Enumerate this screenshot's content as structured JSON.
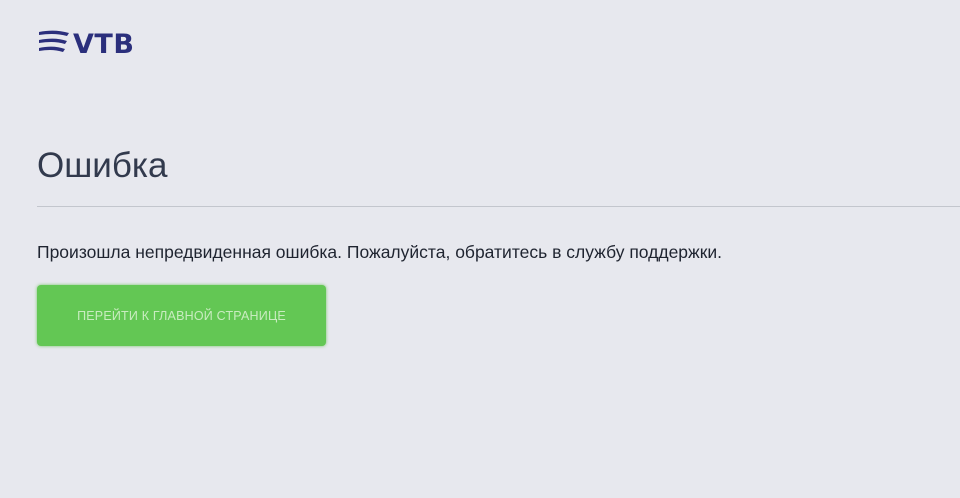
{
  "brand": {
    "logo_text": "VTB",
    "brand_color": "#2b2f7c"
  },
  "error": {
    "title": "Ошибка",
    "message": "Произошла непредвиденная ошибка. Пожалуйста, обратитесь в службу поддержки."
  },
  "actions": {
    "home_button_label": "Перейти к главной странице",
    "home_button_color": "#63c754"
  },
  "icons": {
    "logo_mark": "vtb-sail-logo-icon"
  }
}
